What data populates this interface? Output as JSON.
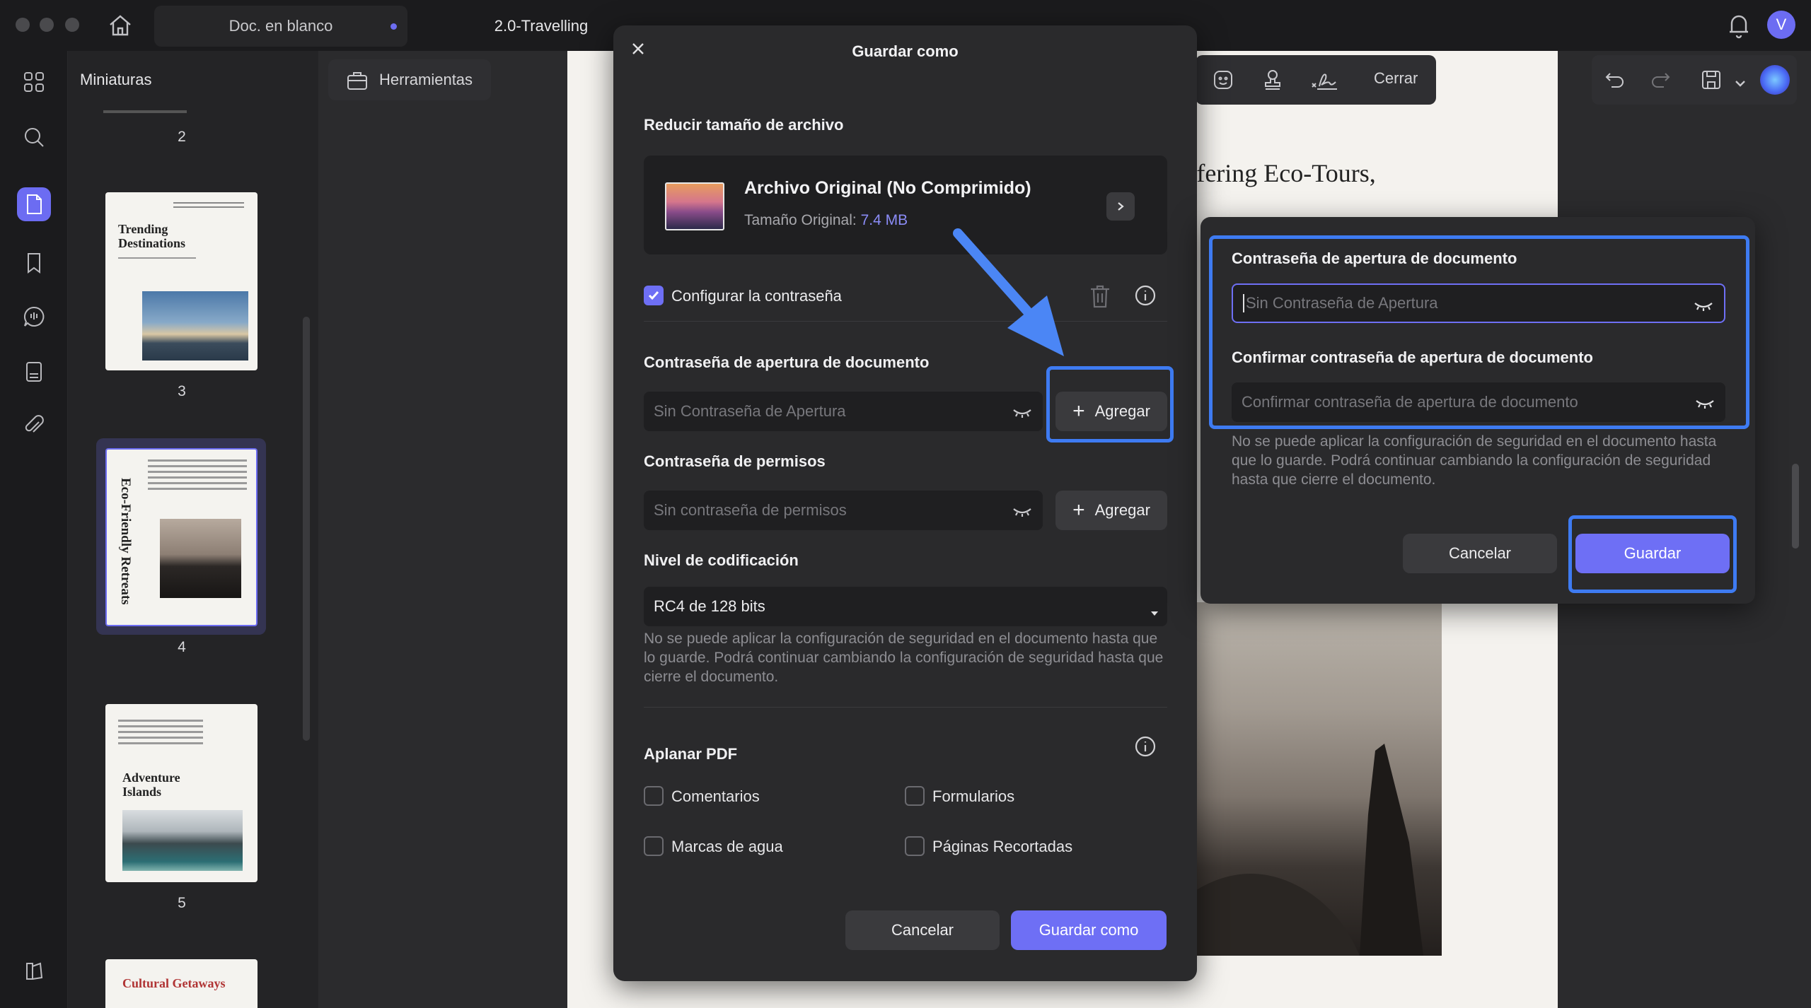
{
  "window": {
    "tabs": [
      {
        "label": "Doc. en blanco"
      },
      {
        "label": "2.0-Travelling"
      }
    ],
    "user_initial": "V"
  },
  "thumbnails": {
    "header": "Miniaturas",
    "pages": [
      {
        "number": "2"
      },
      {
        "number": "3",
        "title_line1": "Trending",
        "title_line2": "Destinations"
      },
      {
        "number": "4",
        "title": "Eco-Friendly Retreats"
      },
      {
        "number": "5",
        "title_line1": "Adventure",
        "title_line2": "Islands"
      },
      {
        "title": "Cultural Getaways"
      }
    ]
  },
  "toolbar": {
    "tools_label": "Herramientas",
    "close_label": "Cerrar"
  },
  "document": {
    "visible_heading": "ffering Eco-Tours,"
  },
  "dialog": {
    "title": "Guardar como",
    "reduce_title": "Reducir tamaño de archivo",
    "original_title": "Archivo Original (No Comprimido)",
    "original_size_label": "Tamaño Original:",
    "original_size_value": "7.4 MB",
    "set_password_label": "Configurar la contraseña",
    "open_password_title": "Contraseña de apertura de documento",
    "open_password_placeholder": "Sin Contraseña de Apertura",
    "add_label": "Agregar",
    "permissions_title": "Contraseña de permisos",
    "permissions_placeholder": "Sin contraseña de permisos",
    "encryption_title": "Nivel de codificación",
    "encryption_value": "RC4 de 128 bits",
    "security_note": "No se puede aplicar la configuración de seguridad en el documento hasta que lo guarde. Podrá continuar cambiando la configuración de seguridad hasta que cierre el documento.",
    "flatten_title": "Aplanar PDF",
    "flatten_options": [
      {
        "label": "Comentarios"
      },
      {
        "label": "Formularios"
      },
      {
        "label": "Marcas de agua"
      },
      {
        "label": "Páginas Recortadas"
      }
    ],
    "cancel_label": "Cancelar",
    "save_as_label": "Guardar como"
  },
  "popup": {
    "open_password_title": "Contraseña de apertura de documento",
    "open_password_placeholder": "Sin Contraseña de Apertura",
    "confirm_title": "Confirmar contraseña de apertura de documento",
    "confirm_placeholder": "Confirmar contraseña de apertura de documento",
    "note": "No se puede aplicar la configuración de seguridad en el documento hasta que lo guarde. Podrá continuar cambiando la configuración de seguridad hasta que cierre el documento.",
    "cancel_label": "Cancelar",
    "save_label": "Guardar"
  },
  "colors": {
    "accent": "#6e6ff5",
    "highlight": "#3e7bf2",
    "arrow": "#4b86f5"
  }
}
